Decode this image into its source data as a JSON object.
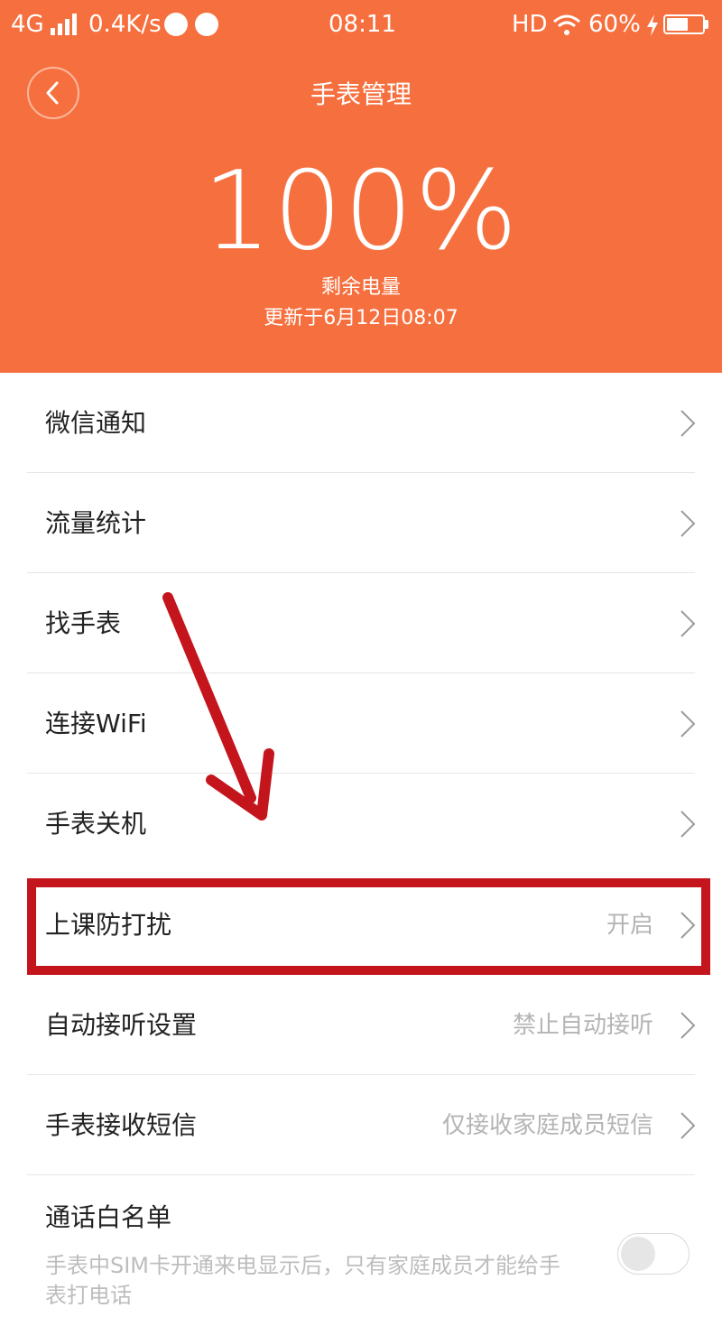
{
  "status_bar": {
    "network": "4G",
    "speed": "0.4K/s",
    "time": "08:11",
    "hd": "HD",
    "battery": "60%",
    "battery_level": 0.6
  },
  "header": {
    "title": "手表管理",
    "battery_percent": "100%",
    "battery_label": "剩余电量",
    "updated": "更新于6月12日08:07",
    "accent_color": "#f6703f"
  },
  "menu": [
    {
      "label": "微信通知",
      "value": ""
    },
    {
      "label": "流量统计",
      "value": ""
    },
    {
      "label": "找手表",
      "value": ""
    },
    {
      "label": "连接WiFi",
      "value": ""
    },
    {
      "label": "手表关机",
      "value": ""
    },
    {
      "label": "上课防打扰",
      "value": "开启",
      "highlighted": true
    },
    {
      "label": "自动接听设置",
      "value": "禁止自动接听"
    },
    {
      "label": "手表接收短信",
      "value": "仅接收家庭成员短信"
    }
  ],
  "whitelist": {
    "title": "通话白名单",
    "description": "手表中SIM卡开通来电显示后，只有家庭成员才能给手表打电话",
    "enabled": false
  },
  "annotation_color": "#c4151c"
}
